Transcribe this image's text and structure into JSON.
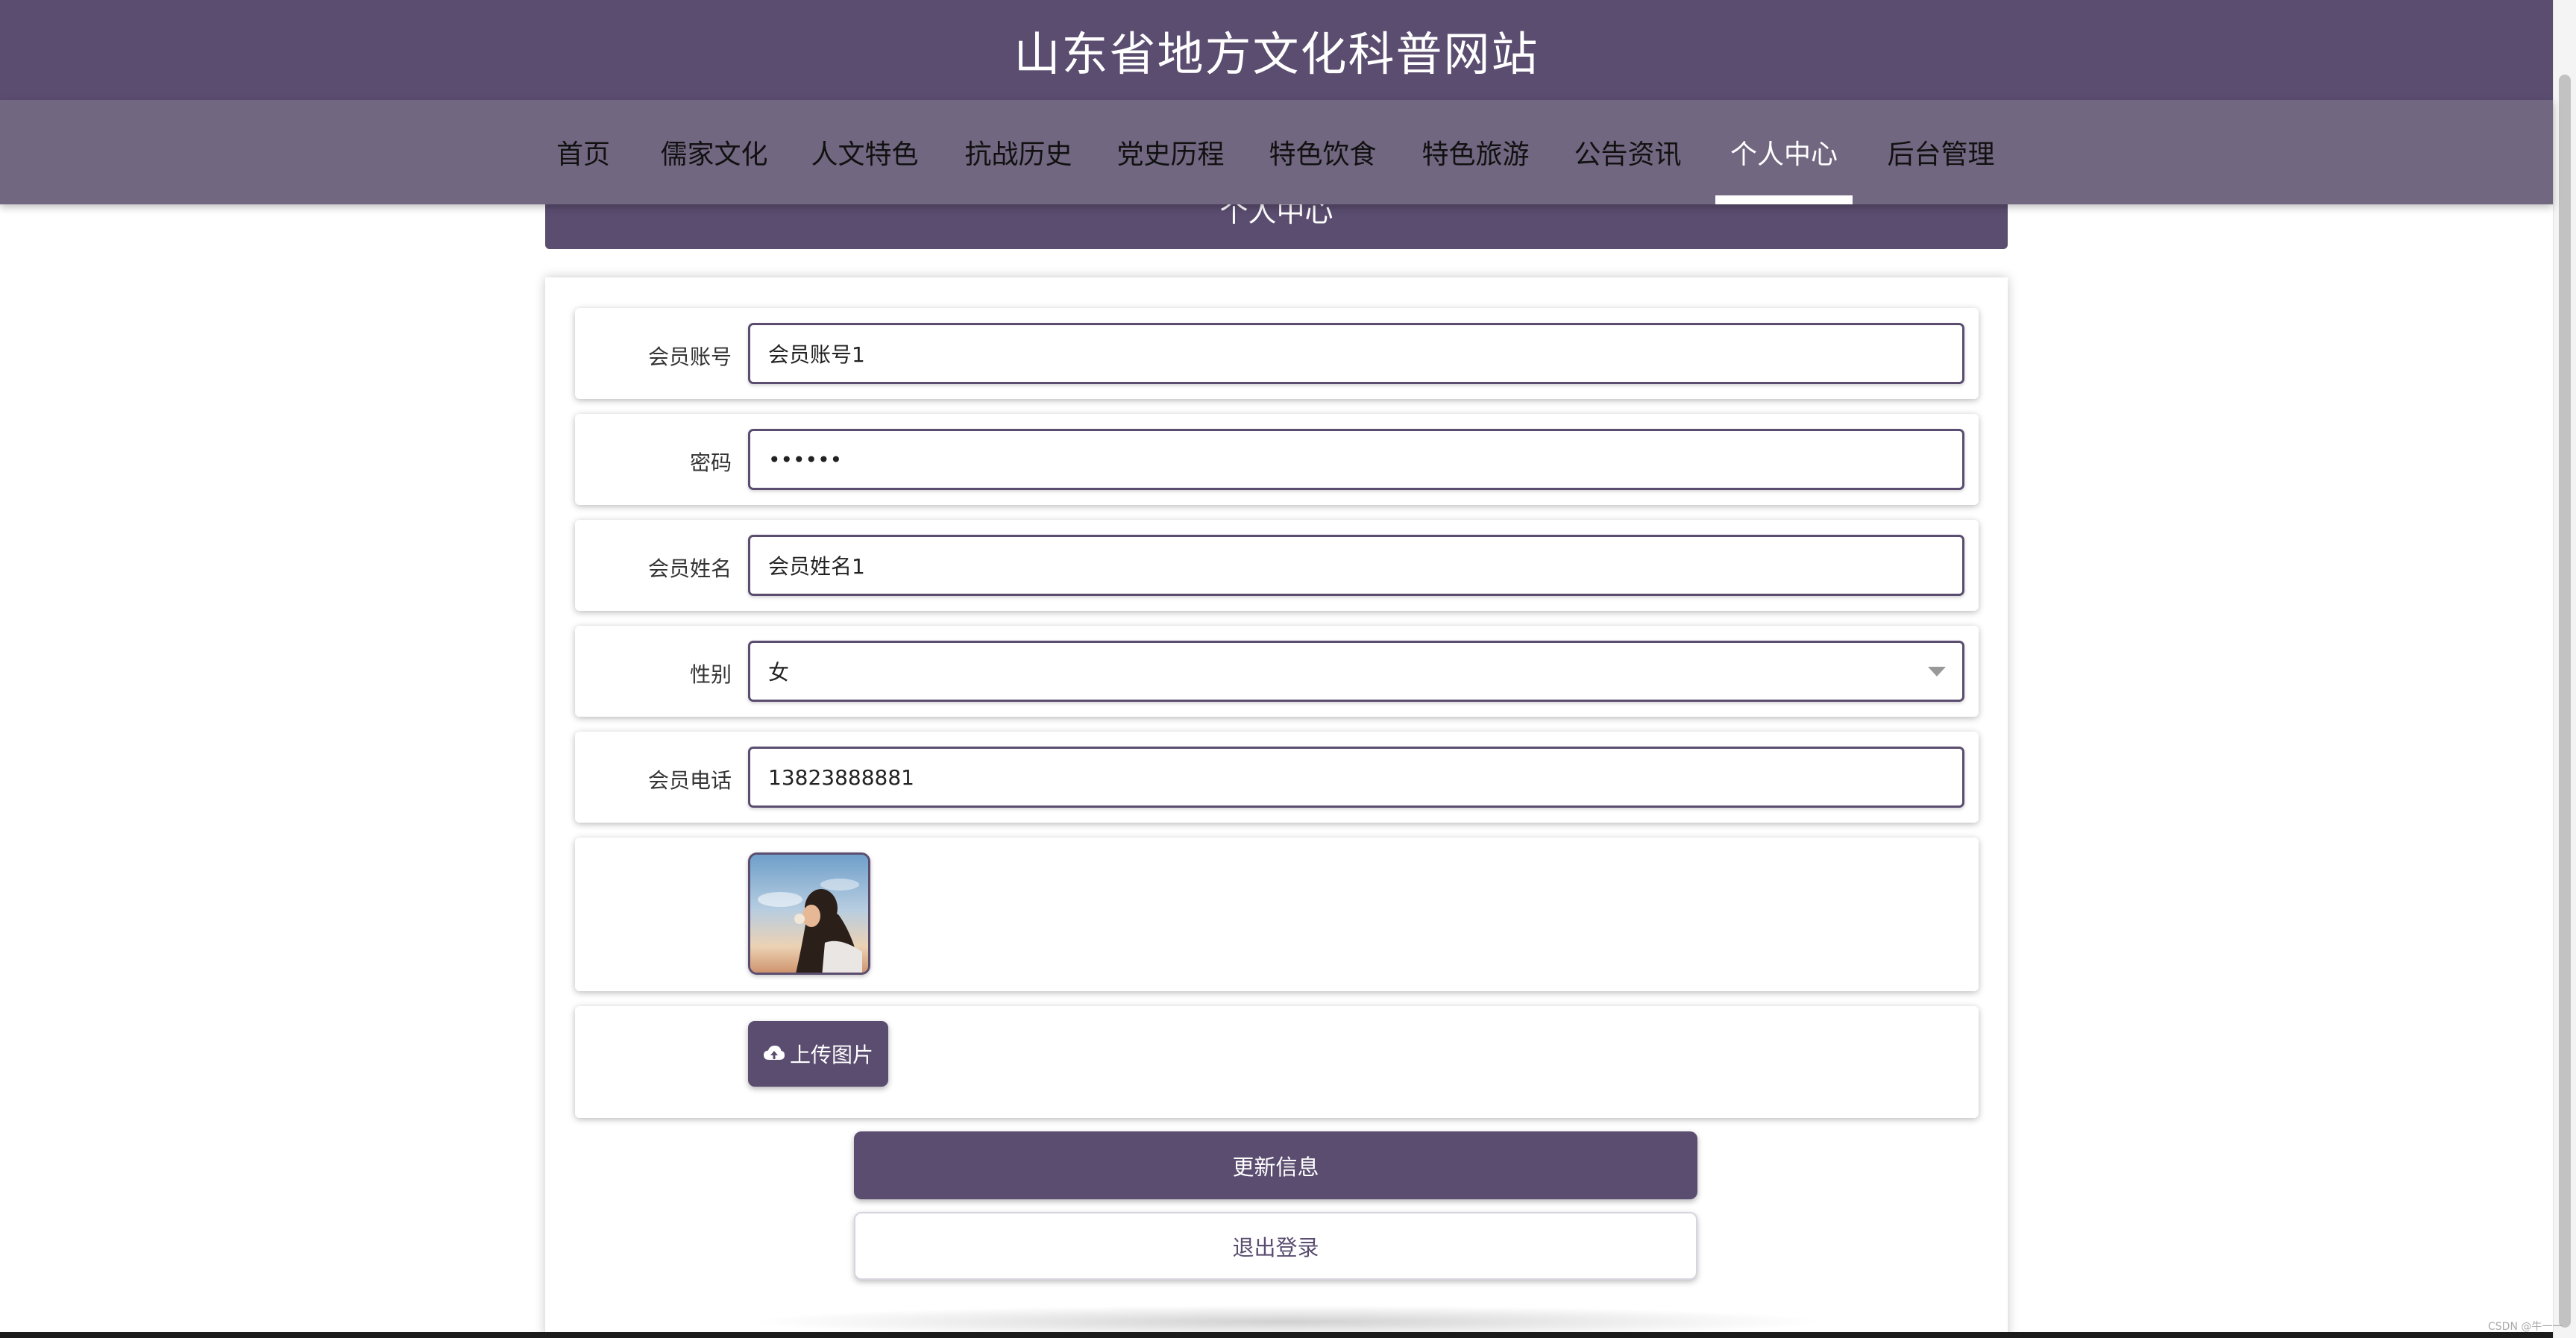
{
  "site_title": "山东省地方文化科普网站",
  "nav": {
    "items": [
      {
        "label": "首页",
        "active": false
      },
      {
        "label": "儒家文化",
        "active": false
      },
      {
        "label": "人文特色",
        "active": false
      },
      {
        "label": "抗战历史",
        "active": false
      },
      {
        "label": "党史历程",
        "active": false
      },
      {
        "label": "特色饮食",
        "active": false
      },
      {
        "label": "特色旅游",
        "active": false
      },
      {
        "label": "公告资讯",
        "active": false
      },
      {
        "label": "个人中心",
        "active": true
      },
      {
        "label": "后台管理",
        "active": false
      }
    ]
  },
  "section_title": "个人中心",
  "form": {
    "account": {
      "label": "会员账号",
      "value": "会员账号1"
    },
    "password": {
      "label": "密码",
      "value": "••••••"
    },
    "name": {
      "label": "会员姓名",
      "value": "会员姓名1"
    },
    "gender": {
      "label": "性别",
      "value": "女"
    },
    "phone": {
      "label": "会员电话",
      "value": "13823888881"
    },
    "upload_label": "上传图片"
  },
  "buttons": {
    "update": "更新信息",
    "logout": "退出登录"
  },
  "watermark": "CSDN @牛一一",
  "colors": {
    "primary": "#5b4d70",
    "nav_bg": "#726781",
    "active_nav_text": "#ffffff"
  }
}
